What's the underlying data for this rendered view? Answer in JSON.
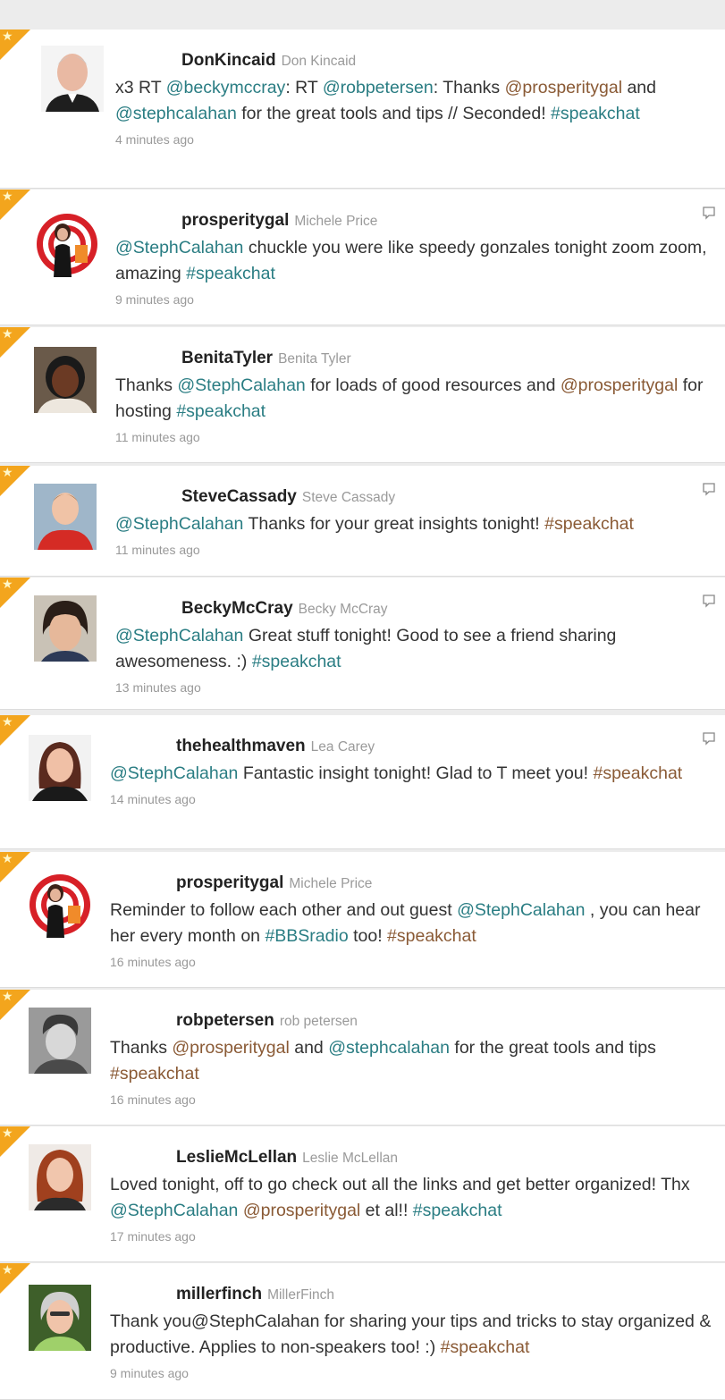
{
  "accent": {
    "fav": "#f3a51d",
    "mention": "#2a7d83",
    "username": "#222222"
  },
  "tweets": [
    {
      "screen_name": "DonKincaid",
      "full_name": "Don Kincaid",
      "segments": [
        {
          "t": "x3 RT "
        },
        {
          "t": "@beckymccray",
          "k": "mention"
        },
        {
          "t": ": RT "
        },
        {
          "t": "@robpetersen",
          "k": "mention"
        },
        {
          "t": ": Thanks "
        },
        {
          "t": "@prosperitygal",
          "k": "link"
        },
        {
          "t": " and "
        },
        {
          "t": "@stephcalahan",
          "k": "mention"
        },
        {
          "t": " for the great tools and tips // Seconded! "
        },
        {
          "t": "#speakchat",
          "k": "hashtag"
        }
      ],
      "time": "4 minutes ago",
      "reply_icon": false,
      "avatar_icon": "avatar-man-suit-icon"
    },
    {
      "screen_name": "prosperitygal",
      "full_name": "Michele Price",
      "segments": [
        {
          "t": "@StephCalahan",
          "k": "mention"
        },
        {
          "t": " chuckle you were like speedy gonzales tonight zoom zoom, amazing "
        },
        {
          "t": "#speakchat",
          "k": "hashtag"
        }
      ],
      "time": "9 minutes ago",
      "reply_icon": true,
      "avatar_icon": "avatar-prosperity-logo-icon"
    },
    {
      "screen_name": "BenitaTyler",
      "full_name": "Benita Tyler",
      "segments": [
        {
          "t": "Thanks "
        },
        {
          "t": "@StephCalahan",
          "k": "mention"
        },
        {
          "t": " for loads of good resources and "
        },
        {
          "t": "@prosperitygal",
          "k": "link"
        },
        {
          "t": " for hosting "
        },
        {
          "t": "#speakchat",
          "k": "hashtag"
        }
      ],
      "time": "11 minutes ago",
      "reply_icon": false,
      "avatar_icon": "avatar-woman-icon"
    },
    {
      "screen_name": "SteveCassady",
      "full_name": "Steve Cassady",
      "segments": [
        {
          "t": "@StephCalahan",
          "k": "mention"
        },
        {
          "t": " Thanks for your great insights tonight! "
        },
        {
          "t": "#speakchat",
          "k": "link"
        }
      ],
      "time": "11 minutes ago",
      "reply_icon": true,
      "avatar_icon": "avatar-man-red-shirt-icon"
    },
    {
      "screen_name": "BeckyMcCray",
      "full_name": "Becky McCray",
      "segments": [
        {
          "t": "@StephCalahan",
          "k": "mention"
        },
        {
          "t": " Great stuff tonight! Good to see a friend sharing awesomeness. :) "
        },
        {
          "t": "#speakchat",
          "k": "hashtag"
        }
      ],
      "time": "13 minutes ago",
      "reply_icon": true,
      "avatar_icon": "avatar-woman-short-hair-icon"
    },
    {
      "screen_name": "thehealthmaven",
      "full_name": "Lea Carey",
      "segments": [
        {
          "t": "@StephCalahan",
          "k": "mention"
        },
        {
          "t": " Fantastic insight tonight! Glad to T meet you! "
        },
        {
          "t": "#speakchat",
          "k": "link"
        }
      ],
      "time": "14 minutes ago",
      "reply_icon": true,
      "avatar_icon": "avatar-woman-dark-hair-icon"
    },
    {
      "screen_name": "prosperitygal",
      "full_name": "Michele Price",
      "segments": [
        {
          "t": "Reminder to follow each other and out guest "
        },
        {
          "t": "@StephCalahan",
          "k": "mention"
        },
        {
          "t": " , you can hear her every month on "
        },
        {
          "t": "#BBSradio",
          "k": "hashtag"
        },
        {
          "t": " too! "
        },
        {
          "t": "#speakchat",
          "k": "link"
        }
      ],
      "time": "16 minutes ago",
      "reply_icon": false,
      "avatar_icon": "avatar-prosperity-logo-icon"
    },
    {
      "screen_name": "robpetersen",
      "full_name": "rob petersen",
      "segments": [
        {
          "t": "Thanks "
        },
        {
          "t": "@prosperitygal",
          "k": "link"
        },
        {
          "t": " and "
        },
        {
          "t": "@stephcalahan",
          "k": "mention"
        },
        {
          "t": " for the great tools and tips "
        },
        {
          "t": "#speakchat",
          "k": "link"
        }
      ],
      "time": "16 minutes ago",
      "reply_icon": false,
      "avatar_icon": "avatar-man-grayscale-icon"
    },
    {
      "screen_name": "LeslieMcLellan",
      "full_name": "Leslie McLellan",
      "segments": [
        {
          "t": "Loved tonight, off to go check out all the links and get better organized! Thx "
        },
        {
          "t": "@StephCalahan",
          "k": "mention"
        },
        {
          "t": " "
        },
        {
          "t": "@prosperitygal",
          "k": "link"
        },
        {
          "t": " et al!! "
        },
        {
          "t": "#speakchat",
          "k": "hashtag"
        }
      ],
      "time": "17 minutes ago",
      "reply_icon": false,
      "avatar_icon": "avatar-woman-red-hair-icon"
    },
    {
      "screen_name": "millerfinch",
      "full_name": "MillerFinch",
      "segments": [
        {
          "t": "Thank you@StephCalahan for sharing your tips and tricks to stay organized & productive. Applies to non-speakers too! :) "
        },
        {
          "t": "#speakchat",
          "k": "link"
        }
      ],
      "time": "9 minutes ago",
      "reply_icon": false,
      "avatar_icon": "avatar-woman-gray-hair-icon"
    }
  ]
}
